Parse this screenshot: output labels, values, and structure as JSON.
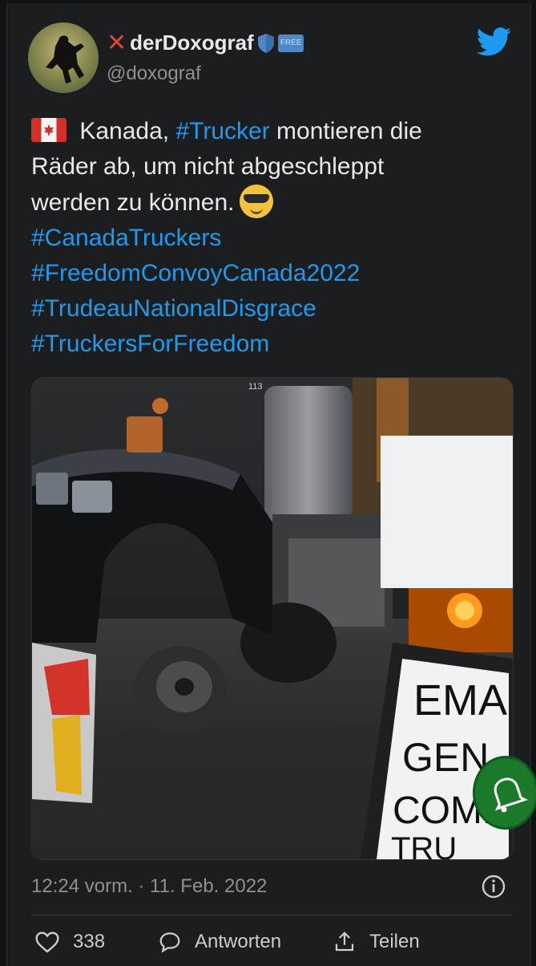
{
  "header": {
    "display_name": "derDoxograf",
    "handle": "@doxograf",
    "badge_label": "FREE",
    "icons": [
      "x-mark-icon",
      "shield-icon",
      "twitter-bird-icon"
    ],
    "accent": "#1d9bf0"
  },
  "tweet": {
    "line1_text": " Kanada, ",
    "line1_hashtag": "#Trucker",
    "line1_rest": " montieren die",
    "line2": "Räder ab, um nicht abgeschleppt",
    "line3": "werden zu können.",
    "hashtags": [
      "#CanadaTruckers",
      "#FreedomConvoyCanada2022",
      "#TrudeauNationalDisgrace",
      "#TruckersForFreedom"
    ],
    "emoji_flag": "canada-flag",
    "emoji_face": "sunglasses-face"
  },
  "photo": {
    "sign_text_lines": [
      "EMA",
      "GEN",
      "COMP",
      "TRU"
    ],
    "truck_number": "113"
  },
  "meta": {
    "timestamp": "12:24 vorm. · 11. Feb. 2022"
  },
  "actions": {
    "like_count": "338",
    "reply_label": "Antworten",
    "share_label": "Teilen"
  }
}
